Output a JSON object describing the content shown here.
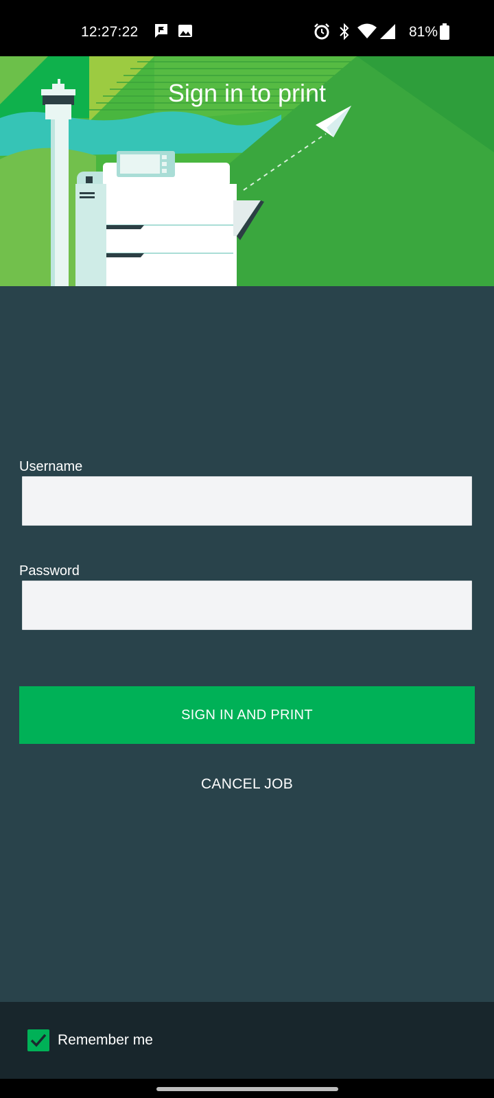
{
  "status_bar": {
    "time": "12:27:22",
    "battery": "81%",
    "icons": [
      "chat-notification-icon",
      "image-notification-icon",
      "alarm-icon",
      "bluetooth-icon",
      "wifi-icon",
      "signal-icon",
      "battery-icon"
    ]
  },
  "banner": {
    "title": "Sign in to print"
  },
  "form": {
    "username_label": "Username",
    "username_value": "",
    "password_label": "Password",
    "password_value": ""
  },
  "actions": {
    "sign_in_label": "SIGN IN AND PRINT",
    "cancel_label": "CANCEL JOB"
  },
  "footer": {
    "remember_label": "Remember me",
    "remember_checked": true
  },
  "colors": {
    "accent": "#00b157",
    "background": "#29434b",
    "footer": "#18262c"
  }
}
